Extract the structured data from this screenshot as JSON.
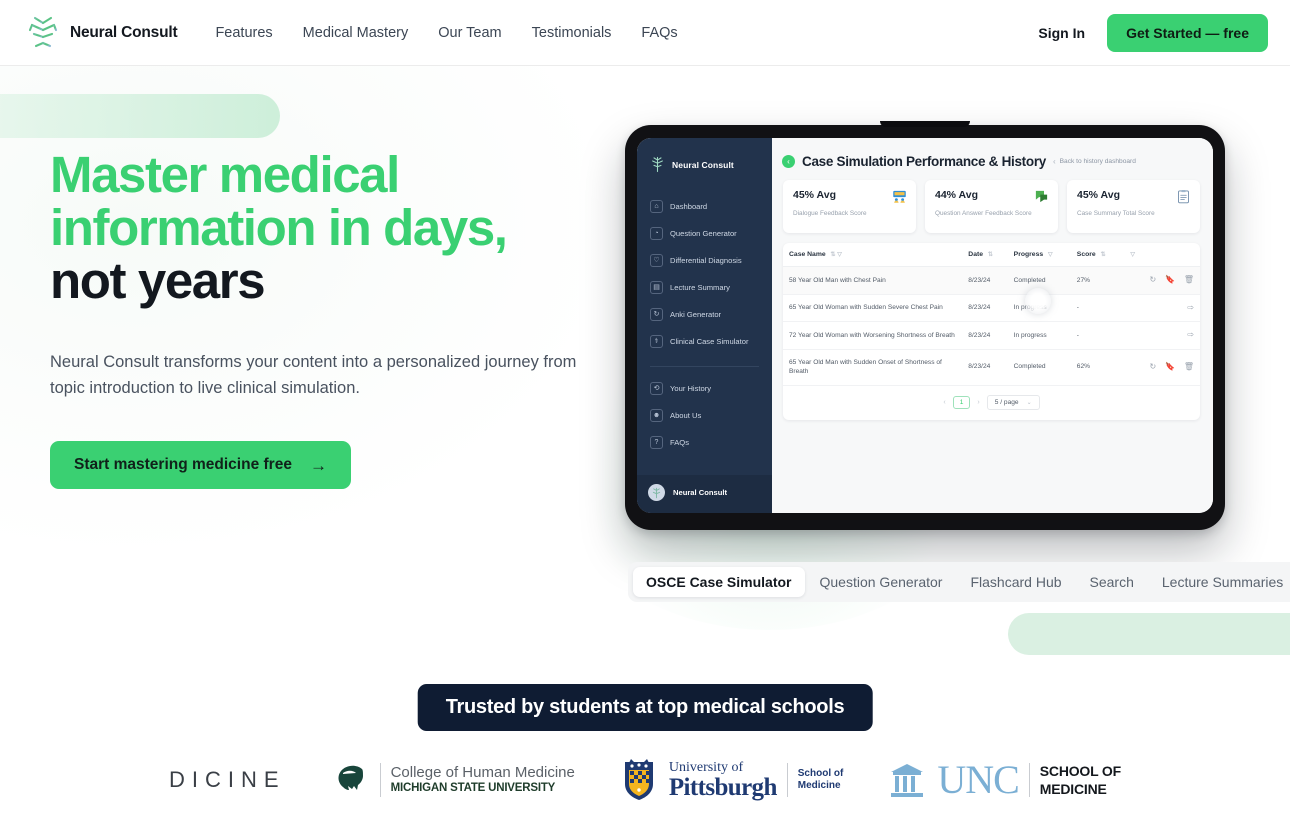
{
  "colors": {
    "accent_green": "#3ad072",
    "deco_green": "#daf0e2",
    "dark_navy": "#0f1c33",
    "sidebar_navy": "#22334c",
    "text_dark": "#13181f",
    "text_muted": "#49525f"
  },
  "header": {
    "brand_name": "Neural Consult",
    "brand_icon": "neuron-tree-logo-icon",
    "nav": [
      {
        "label": "Features"
      },
      {
        "label": "Medical Mastery"
      },
      {
        "label": "Our Team"
      },
      {
        "label": "Testimonials"
      },
      {
        "label": "FAQs"
      }
    ],
    "sign_in": "Sign In",
    "cta": "Get Started — free"
  },
  "hero": {
    "title_line1": "Master medical",
    "title_line2": "information in days,",
    "title_line3": "not years",
    "subtitle": "Neural Consult transforms your content into a personalized journey from topic introduction to live clinical simulation.",
    "cta_label": "Start mastering medicine free",
    "cta_arrow": "→"
  },
  "tablet_app": {
    "sidebar": {
      "brand": "Neural Consult",
      "brand_icon": "neuron-tree-logo-icon",
      "items": [
        {
          "label": "Dashboard",
          "icon": "home-icon"
        },
        {
          "label": "Question Generator",
          "icon": "question-bubble-icon"
        },
        {
          "label": "Differential Diagnosis",
          "icon": "shield-icon"
        },
        {
          "label": "Lecture Summary",
          "icon": "document-icon"
        },
        {
          "label": "Anki Generator",
          "icon": "refresh-card-icon"
        },
        {
          "label": "Clinical Case Simulator",
          "icon": "stethoscope-person-icon"
        }
      ],
      "secondary_items": [
        {
          "label": "Your History",
          "icon": "history-clock-icon"
        },
        {
          "label": "About Us",
          "icon": "person-icon"
        },
        {
          "label": "FAQs",
          "icon": "question-circle-icon"
        }
      ],
      "user": {
        "name": "Neural Consult",
        "avatar_icon": "user-avatar"
      }
    },
    "topbar": {
      "collapse_icon": "chevron-left-circle-icon",
      "title": "Case Simulation Performance & History",
      "back_chevron": "‹",
      "back_label": "Back to history dashboard"
    },
    "stats": [
      {
        "value": "45% Avg",
        "label": "Dialogue Feedback Score",
        "icon": "people-presentation-icon"
      },
      {
        "value": "44% Avg",
        "label": "Question Answer Feedback Score",
        "icon": "green-speech-bubble-icon"
      },
      {
        "value": "45% Avg",
        "label": "Case Summary Total Score",
        "icon": "clipboard-icon"
      }
    ],
    "table": {
      "columns": [
        {
          "label": "Case Name",
          "sort": "⇅",
          "filter": "▼"
        },
        {
          "label": "Date",
          "sort": "⇅",
          "filter": ""
        },
        {
          "label": "Progress",
          "sort": "",
          "filter": "▼"
        },
        {
          "label": "Score",
          "sort": "⇅",
          "filter": ""
        },
        {
          "label": "",
          "sort": "",
          "filter": "▼"
        }
      ],
      "rows": [
        {
          "case_name": "58 Year Old Man with Chest Pain",
          "date": "8/23/24",
          "progress": "Completed",
          "score": "27%",
          "actions": [
            "refresh-icon",
            "bookmark-icon",
            "trash-icon"
          ]
        },
        {
          "case_name": "65 Year Old Woman with Sudden Severe Chest Pain",
          "date": "8/23/24",
          "progress": "In progress",
          "score": "-",
          "actions": [
            "play-forward-icon"
          ]
        },
        {
          "case_name": "72 Year Old Woman with Worsening Shortness of Breath",
          "date": "8/23/24",
          "progress": "In progress",
          "score": "-",
          "actions": [
            "play-forward-icon"
          ]
        },
        {
          "case_name": "65 Year Old Man with Sudden Onset of Shortness of Breath",
          "date": "8/23/24",
          "progress": "Completed",
          "score": "62%",
          "actions": [
            "refresh-icon",
            "bookmark-icon",
            "trash-icon"
          ]
        }
      ],
      "pagination": {
        "prev": "‹",
        "current_page": "1",
        "next": "›",
        "page_size": "5 / page",
        "page_size_caret": "⌄"
      }
    }
  },
  "feature_tabs": {
    "items": [
      {
        "label": "OSCE Case Simulator",
        "active": true
      },
      {
        "label": "Question Generator",
        "active": false
      },
      {
        "label": "Flashcard Hub",
        "active": false
      },
      {
        "label": "Search",
        "active": false
      },
      {
        "label": "Lecture Summaries",
        "active": false
      }
    ]
  },
  "trusted": {
    "banner": "Trusted by students at top medical schools"
  },
  "logos": [
    {
      "name": "partial-medicine-wordmark",
      "text": "DICINE"
    },
    {
      "name": "michigan-state-college-of-human-medicine",
      "line1": "College of Human Medicine",
      "line2": "MICHIGAN STATE UNIVERSITY",
      "icon": "spartan-helmet-icon"
    },
    {
      "name": "university-of-pittsburgh-school-of-medicine",
      "line1": "University of",
      "line2": "Pittsburgh",
      "sub1": "School of",
      "sub2": "Medicine",
      "icon": "pitt-shield-icon"
    },
    {
      "name": "unc-school-of-medicine",
      "word": "UNC",
      "sub1": "SCHOOL OF",
      "sub2": "MEDICINE",
      "icon": "old-well-columns-icon"
    }
  ]
}
